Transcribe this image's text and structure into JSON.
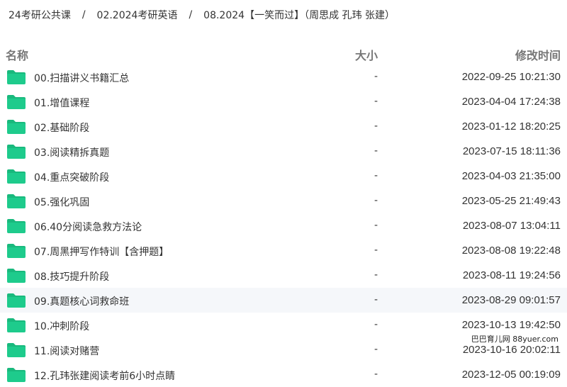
{
  "breadcrumb": {
    "items": [
      "24考研公共课",
      "02.2024考研英语",
      "08.2024【一笑而过】（周思成 孔玮 张建）"
    ],
    "separator": "/"
  },
  "columns": {
    "name": "名称",
    "size": "大小",
    "modified": "修改时间"
  },
  "colors": {
    "folder": "#1ecb8c",
    "folder_tab": "#19b97d",
    "hover_row": "#f5f7fa"
  },
  "rows": [
    {
      "name": "00.扫描讲义书籍汇总",
      "size": "-",
      "modified": "2022-09-25 10:21:30"
    },
    {
      "name": "01.增值课程",
      "size": "-",
      "modified": "2023-04-04 17:24:38"
    },
    {
      "name": "02.基础阶段",
      "size": "-",
      "modified": "2023-01-12 18:20:25"
    },
    {
      "name": "03.阅读精拆真题",
      "size": "-",
      "modified": "2023-07-15 18:11:36"
    },
    {
      "name": "04.重点突破阶段",
      "size": "-",
      "modified": "2023-04-03 21:35:00"
    },
    {
      "name": "05.强化巩固",
      "size": "-",
      "modified": "2023-05-25 21:49:43"
    },
    {
      "name": "06.40分阅读急救方法论",
      "size": "-",
      "modified": "2023-08-07 13:04:11"
    },
    {
      "name": "07.周黑押写作特训【含押题】",
      "size": "-",
      "modified": "2023-08-08 19:22:48"
    },
    {
      "name": "08.技巧提升阶段",
      "size": "-",
      "modified": "2023-08-11 19:24:56"
    },
    {
      "name": "09.真题核心词救命班",
      "size": "-",
      "modified": "2023-08-29 09:01:57"
    },
    {
      "name": "10.冲刺阶段",
      "size": "-",
      "modified": "2023-10-13 19:42:50"
    },
    {
      "name": "11.阅读对赌营",
      "size": "-",
      "modified": "2023-10-16 20:02:11"
    },
    {
      "name": "12.孔玮张建阅读考前6小时点睛",
      "size": "-",
      "modified": "2023-12-05 00:19:09"
    }
  ],
  "watermark": "巴巴育儿网 88yuer.com"
}
